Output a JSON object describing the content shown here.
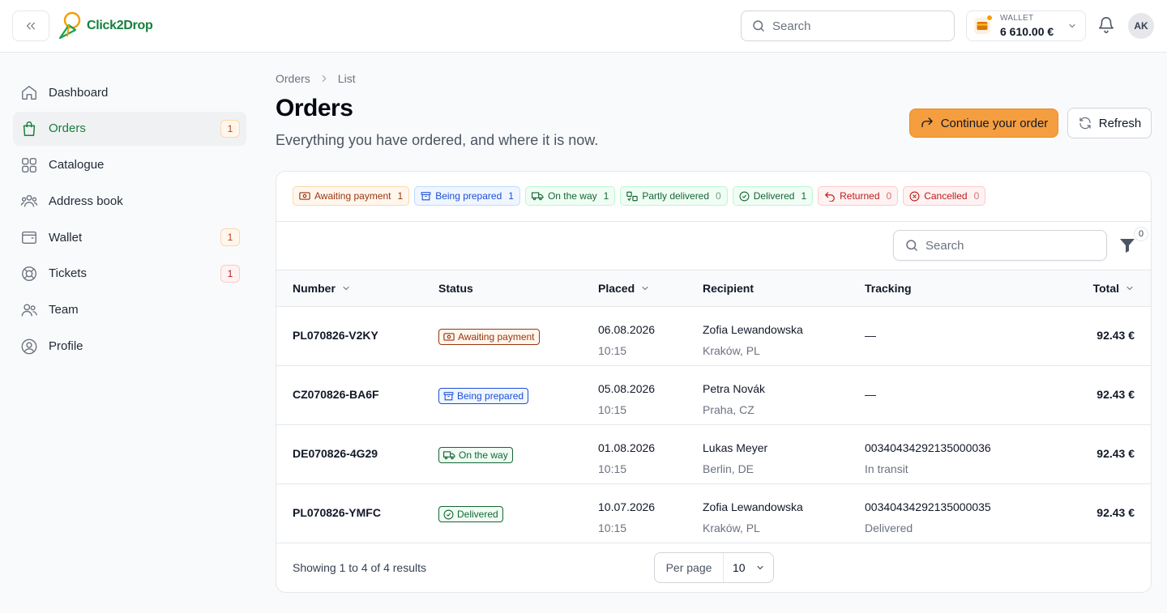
{
  "brand": {
    "name": "Click2Drop"
  },
  "header": {
    "search_placeholder": "Search",
    "wallet_label": "WALLET",
    "wallet_amount": "6 610.00 €",
    "avatar_initials": "AK"
  },
  "sidebar": {
    "items": [
      {
        "label": "Dashboard",
        "icon": "home-icon",
        "badge": ""
      },
      {
        "label": "Orders",
        "icon": "shopping-bag-icon",
        "badge": "1",
        "active": true
      },
      {
        "label": "Catalogue",
        "icon": "grid-icon",
        "badge": ""
      },
      {
        "label": "Address book",
        "icon": "users-group-icon",
        "badge": ""
      },
      {
        "label": "Wallet",
        "icon": "wallet-icon",
        "badge": "1"
      },
      {
        "label": "Tickets",
        "icon": "lifebuoy-icon",
        "badge": "1"
      },
      {
        "label": "Team",
        "icon": "team-icon",
        "badge": ""
      },
      {
        "label": "Profile",
        "icon": "user-circle-icon",
        "badge": ""
      }
    ]
  },
  "breadcrumb": {
    "root": "Orders",
    "current": "List"
  },
  "page": {
    "title": "Orders",
    "subtitle": "Everything you have ordered, and where it is now.",
    "continue_label": "Continue your order",
    "refresh_label": "Refresh"
  },
  "status_tabs": [
    {
      "label": "Awaiting payment",
      "count": "1",
      "color": "#9a3412"
    },
    {
      "label": "Being prepared",
      "count": "1",
      "color": "#1d4ed8"
    },
    {
      "label": "On the way",
      "count": "1",
      "color": "#166534"
    },
    {
      "label": "Partly delivered",
      "count": "0",
      "color": "#166534"
    },
    {
      "label": "Delivered",
      "count": "1",
      "color": "#166534"
    },
    {
      "label": "Returned",
      "count": "0",
      "color": "#b91c1c"
    },
    {
      "label": "Cancelled",
      "count": "0",
      "color": "#b91c1c"
    }
  ],
  "table": {
    "search_placeholder": "Search",
    "filter_count": "0",
    "columns": {
      "number": "Number",
      "status": "Status",
      "placed": "Placed",
      "recipient": "Recipient",
      "tracking": "Tracking",
      "total": "Total"
    },
    "rows": [
      {
        "number": "PL070826-V2KY",
        "status": "Awaiting payment",
        "date": "06.08.2026",
        "time": "10:15",
        "recipient": "Zofia Lewandowska",
        "city": "Kraków, PL",
        "tracking": "—",
        "tracking_status": "",
        "total": "92.43 €"
      },
      {
        "number": "CZ070826-BA6F",
        "status": "Being prepared",
        "date": "05.08.2026",
        "time": "10:15",
        "recipient": "Petra Novák",
        "city": "Praha, CZ",
        "tracking": "—",
        "tracking_status": "",
        "total": "92.43 €"
      },
      {
        "number": "DE070826-4G29",
        "status": "On the way",
        "date": "01.08.2026",
        "time": "10:15",
        "recipient": "Lukas Meyer",
        "city": "Berlin, DE",
        "tracking": "00340434292135000036",
        "tracking_status": "In transit",
        "total": "92.43 €"
      },
      {
        "number": "PL070826-YMFC",
        "status": "Delivered",
        "date": "10.07.2026",
        "time": "10:15",
        "recipient": "Zofia Lewandowska",
        "city": "Kraków, PL",
        "tracking": "00340434292135000035",
        "tracking_status": "Delivered",
        "total": "92.43 €"
      }
    ],
    "footer_text": "Showing 1 to 4 of 4 results",
    "per_page_label": "Per page",
    "per_page_value": "10"
  }
}
